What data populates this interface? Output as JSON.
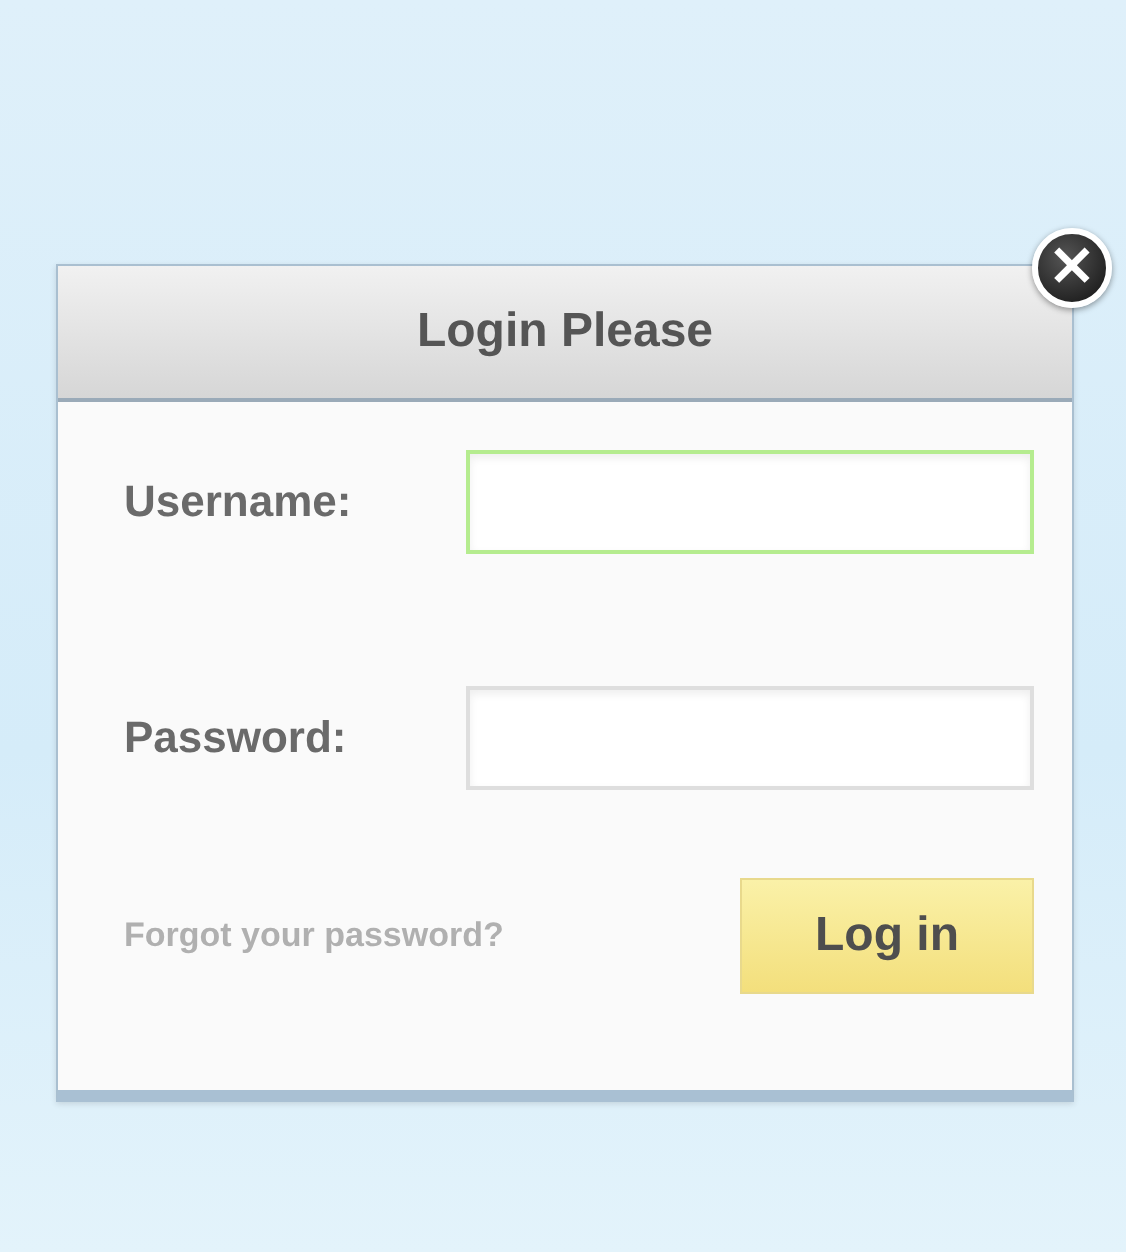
{
  "dialog": {
    "title": "Login Please",
    "close": "×"
  },
  "fields": [
    {
      "label": "Username:",
      "focused": true
    },
    {
      "label": "Password:",
      "focused": false
    }
  ],
  "forgot_link": "Forgot your password?",
  "submit_button": "Log in"
}
